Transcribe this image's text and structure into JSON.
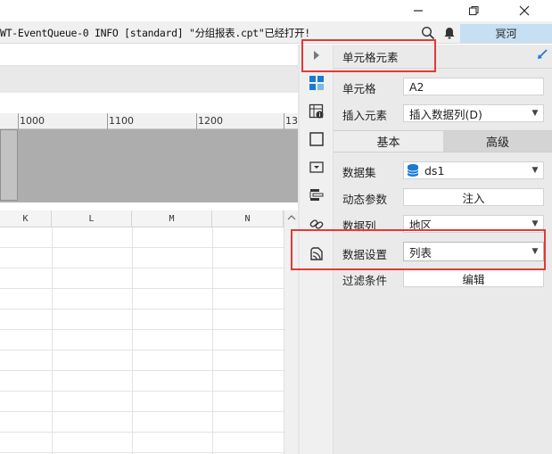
{
  "colors": {
    "accent": "#1a7ad6",
    "highlight_red": "#e53935",
    "user_button": "#c6dff3"
  },
  "titlebar": {
    "search_icon": "search-icon",
    "bell_icon": "bell-icon",
    "user_name": "冥河"
  },
  "log": {
    "text": "WT-EventQueue-0 INFO [standard] \"分组报表.cpt\"已经打开!"
  },
  "ruler": {
    "labels": [
      "1000",
      "1100",
      "1200",
      "13"
    ]
  },
  "grid": {
    "columns": [
      "K",
      "L",
      "M",
      "N"
    ]
  },
  "panel": {
    "title": "单元格元素",
    "cell_label": "单元格",
    "cell_value": "A2",
    "insert_label": "插入元素",
    "insert_value": "插入数据列(D)",
    "tabs": [
      "基本",
      "高级"
    ],
    "dataset_label": "数据集",
    "dataset_value": "ds1",
    "dynparam_label": "动态参数",
    "dynparam_value": "注入",
    "datacol_label": "数据列",
    "datacol_value": "地区",
    "datasetting_label": "数据设置",
    "datasetting_value": "列表",
    "filter_label": "过滤条件",
    "filter_value": "编辑"
  }
}
